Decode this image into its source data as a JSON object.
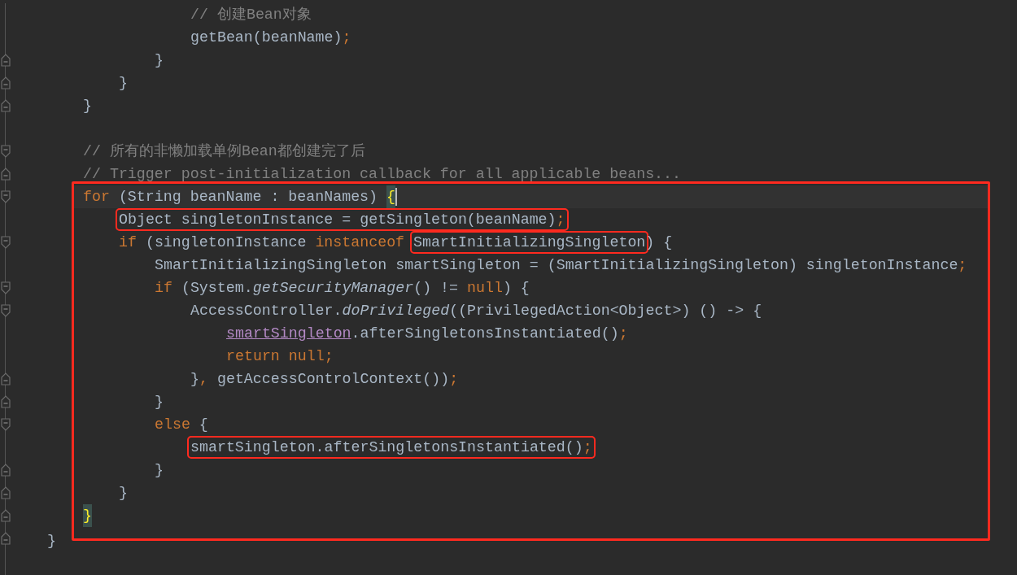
{
  "editor": {
    "lines": [
      {
        "children": [
          {
            "children": [
              {
                "children": [
                  {
                    "children": [
                      {
                        "tokens": [
                          {
                            "text": "// 创建Bean对象",
                            "kind": "comment"
                          }
                        ]
                      },
                      {
                        "tokens": [
                          {
                            "text": "getBean(beanName)",
                            "kind": "plain"
                          },
                          {
                            "text": ";",
                            "kind": "punct"
                          }
                        ]
                      }
                    ]
                  },
                  {
                    "kind": "fold-end",
                    "tokens": [
                      {
                        "text": "}",
                        "kind": "plain"
                      }
                    ]
                  }
                ]
              },
              {
                "kind": "fold-end",
                "tokens": [
                  {
                    "text": "}",
                    "kind": "plain"
                  }
                ]
              }
            ]
          },
          {
            "kind": "fold-end",
            "tokens": [
              {
                "text": "}",
                "kind": "plain"
              }
            ]
          },
          {
            "kind": "blank"
          },
          {
            "kind": "fold-start",
            "tokens": [
              {
                "text": "// 所有的非懒加载单例Bean都创建完了后",
                "kind": "comment"
              }
            ]
          },
          {
            "kind": "fold-end",
            "tokens": [
              {
                "text": "// Trigger post-initialization callback for all applicable beans...",
                "kind": "comment"
              }
            ]
          },
          {
            "kind": "frame",
            "lines": [
              {
                "kind": "fold-start",
                "current": true,
                "caret": true,
                "tokens": [
                  {
                    "text": "for",
                    "kind": "keyword"
                  },
                  {
                    "text": " (String beanName : beanNames) ",
                    "kind": "plain"
                  },
                  {
                    "text": "{",
                    "kind": "brace-match"
                  }
                ],
                "children": [
                  {
                    "tokens": [
                      {
                        "kind": "box",
                        "tokens": [
                          {
                            "text": "Object singletonInstance = getSingleton(beanName)",
                            "kind": "plain"
                          },
                          {
                            "text": ";",
                            "kind": "punct"
                          }
                        ]
                      }
                    ]
                  },
                  {
                    "kind": "fold-start",
                    "tokens": [
                      {
                        "text": "if",
                        "kind": "keyword"
                      },
                      {
                        "text": " (singletonInstance ",
                        "kind": "plain"
                      },
                      {
                        "text": "instanceof",
                        "kind": "keyword"
                      },
                      {
                        "kind": "box",
                        "tokens": [
                          {
                            "text": "SmartInitializingSingleton",
                            "kind": "plain"
                          }
                        ]
                      },
                      {
                        "text": ") {",
                        "kind": "plain"
                      }
                    ],
                    "children": [
                      {
                        "tokens": [
                          {
                            "text": "SmartInitializingSingleton smartSingleton = (SmartInitializingSingleton) singletonInstance",
                            "kind": "plain"
                          },
                          {
                            "text": ";",
                            "kind": "punct"
                          }
                        ]
                      },
                      {
                        "kind": "fold-start",
                        "tokens": [
                          {
                            "text": "if",
                            "kind": "keyword"
                          },
                          {
                            "text": " (System.",
                            "kind": "plain"
                          },
                          {
                            "text": "getSecurityManager",
                            "kind": "italic"
                          },
                          {
                            "text": "() != ",
                            "kind": "plain"
                          },
                          {
                            "text": "null",
                            "kind": "keyword"
                          },
                          {
                            "text": ") {",
                            "kind": "plain"
                          }
                        ],
                        "children": [
                          {
                            "kind": "fold-start",
                            "tokens": [
                              {
                                "text": "AccessController.",
                                "kind": "plain"
                              },
                              {
                                "text": "doPrivileged",
                                "kind": "italic"
                              },
                              {
                                "text": "((PrivilegedAction<Object>) () -> {",
                                "kind": "plain"
                              }
                            ],
                            "children": [
                              {
                                "tokens": [
                                  {
                                    "text": "smartSingleton",
                                    "kind": "link"
                                  },
                                  {
                                    "text": ".afterSingletonsInstantiated()",
                                    "kind": "plain"
                                  },
                                  {
                                    "text": ";",
                                    "kind": "punct"
                                  }
                                ]
                              },
                              {
                                "tokens": [
                                  {
                                    "text": "return null",
                                    "kind": "keyword"
                                  },
                                  {
                                    "text": ";",
                                    "kind": "punct"
                                  }
                                ]
                              }
                            ]
                          },
                          {
                            "kind": "fold-end",
                            "tokens": [
                              {
                                "text": "}",
                                "kind": "plain"
                              },
                              {
                                "text": ",",
                                "kind": "punct"
                              },
                              {
                                "text": " getAccessControlContext())",
                                "kind": "plain"
                              },
                              {
                                "text": ";",
                                "kind": "punct"
                              }
                            ]
                          }
                        ]
                      },
                      {
                        "kind": "fold-end",
                        "tokens": [
                          {
                            "text": "}",
                            "kind": "plain"
                          }
                        ]
                      },
                      {
                        "kind": "fold-start",
                        "tokens": [
                          {
                            "text": "else",
                            "kind": "keyword"
                          },
                          {
                            "text": " {",
                            "kind": "plain"
                          }
                        ],
                        "children": [
                          {
                            "tokens": [
                              {
                                "kind": "box",
                                "tokens": [
                                  {
                                    "text": "smartSingleton.afterSingletonsInstantiated()",
                                    "kind": "plain"
                                  },
                                  {
                                    "text": ";",
                                    "kind": "punct"
                                  }
                                ]
                              }
                            ]
                          }
                        ]
                      },
                      {
                        "kind": "fold-end",
                        "tokens": [
                          {
                            "text": "}",
                            "kind": "plain"
                          }
                        ]
                      }
                    ]
                  },
                  {
                    "kind": "fold-end",
                    "tokens": [
                      {
                        "text": "}",
                        "kind": "plain"
                      }
                    ]
                  }
                ]
              },
              {
                "kind": "fold-end",
                "tokens": [
                  {
                    "text": "}",
                    "kind": "brace-match"
                  }
                ]
              }
            ]
          }
        ]
      },
      {
        "kind": "fold-end",
        "tokens": [
          {
            "text": "}",
            "kind": "plain"
          }
        ]
      }
    ]
  }
}
